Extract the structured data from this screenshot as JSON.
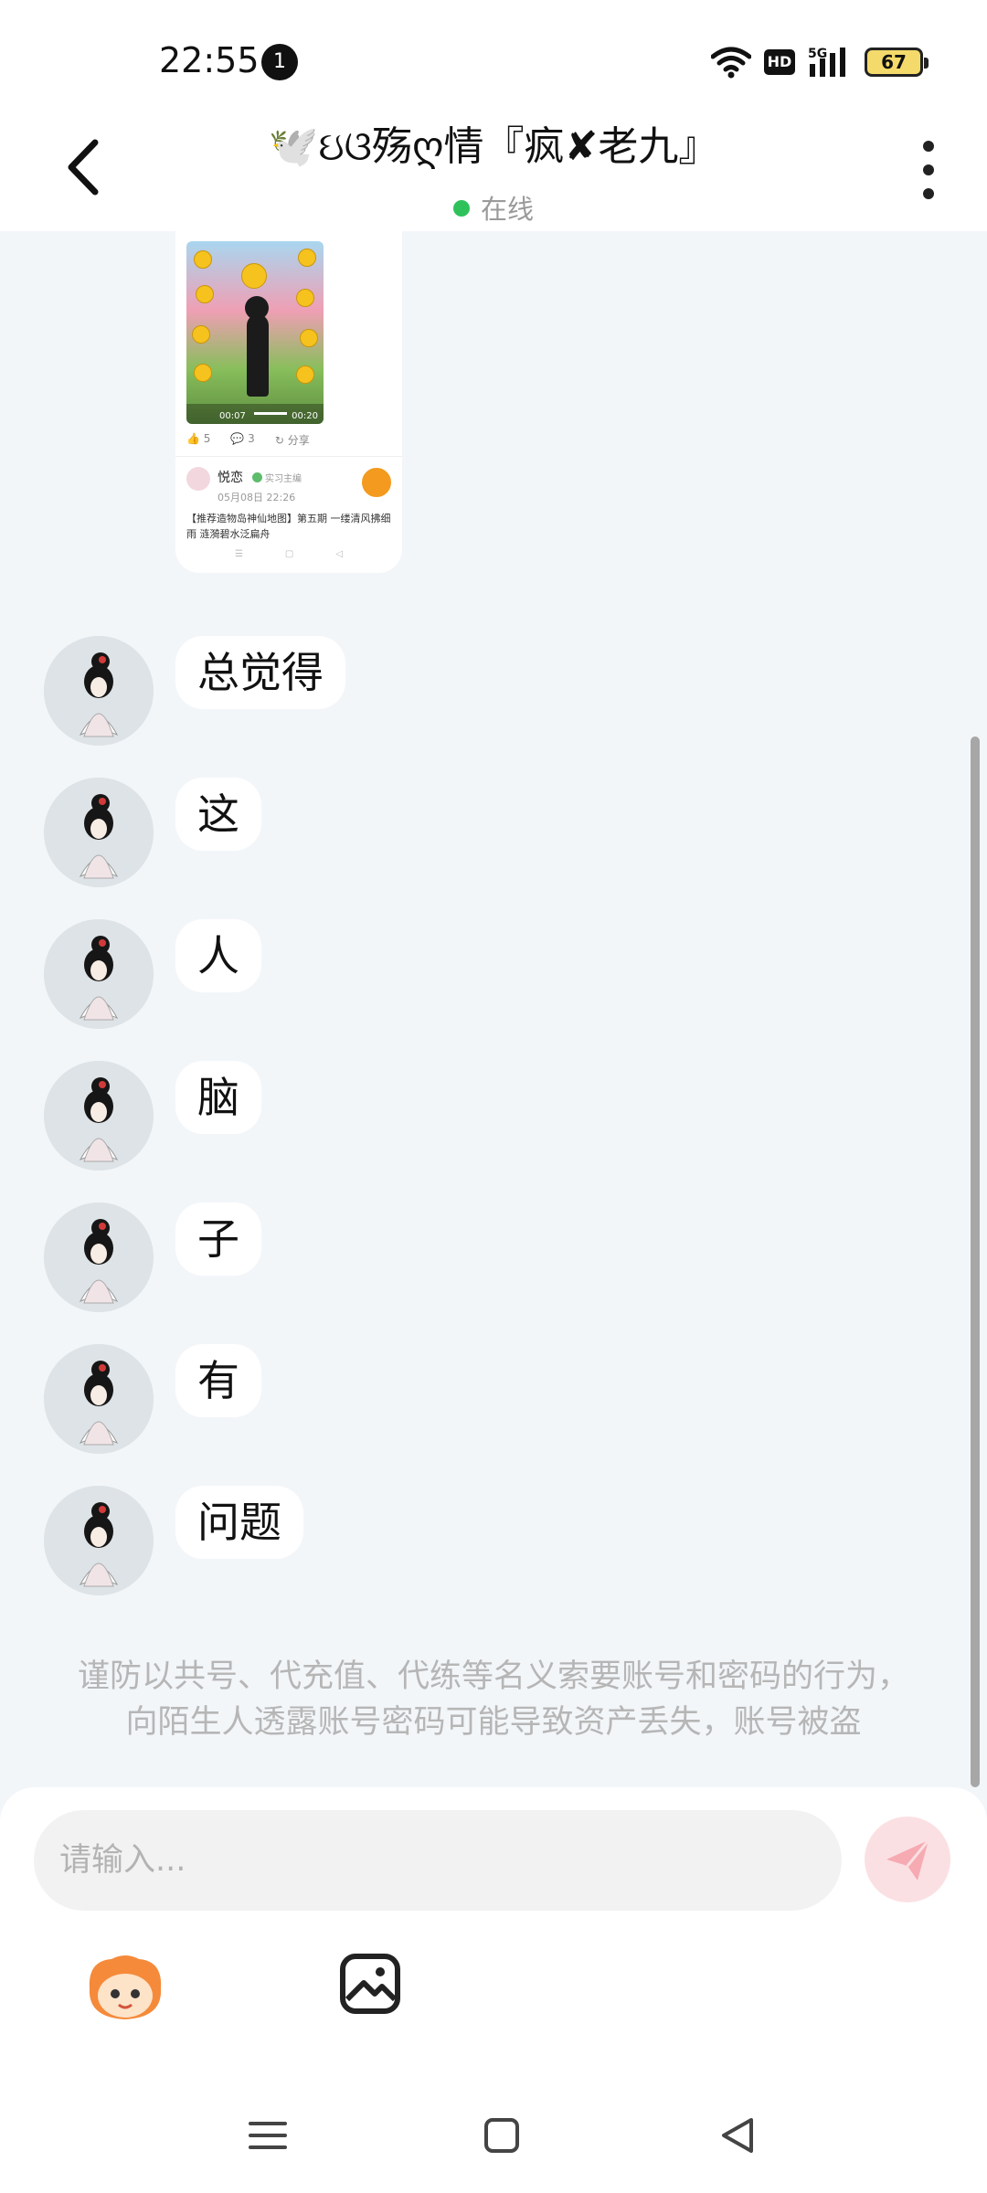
{
  "status_bar": {
    "time": "22:55",
    "notification_count": "1",
    "hd_label": "HD",
    "network_label": "5G",
    "battery": "67"
  },
  "header": {
    "title": "🕊️ઇଓ殇ღ情『疯✘老九』",
    "status": "在线",
    "status_color": "#2fc25b"
  },
  "shared_post": {
    "video_time_current": "00:07",
    "video_time_total": "00:20",
    "likes": "5",
    "comments": "3",
    "share_label": "分享",
    "author": "悦恋",
    "author_role": "实习主编",
    "date": "05月08日 22:26",
    "title": "【推荐造物岛神仙地图】第五期 一缕清风拂细雨 涟漪碧水泛扁舟"
  },
  "messages": [
    {
      "text": "总觉得"
    },
    {
      "text": "这"
    },
    {
      "text": "人"
    },
    {
      "text": "脑"
    },
    {
      "text": "子"
    },
    {
      "text": "有"
    },
    {
      "text": "问题"
    }
  ],
  "notice": "谨防以共号、代充值、代练等名义索要账号和密码的行为，向陌生人透露账号密码可能导致资产丢失，账号被盗",
  "composer": {
    "placeholder": "请输入...",
    "accent": "#f4828f"
  }
}
